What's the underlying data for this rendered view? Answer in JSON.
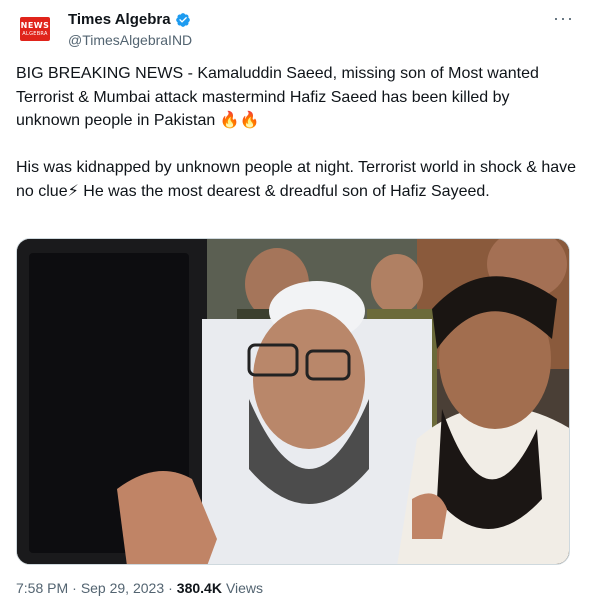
{
  "account": {
    "logo_text": "NEWS",
    "logo_subtext": "ALGEBRA",
    "display_name": "Times Algebra",
    "handle": "@TimesAlgebraIND",
    "verified": true
  },
  "menu": {
    "more_label": "···"
  },
  "tweet": {
    "text": "BIG BREAKING NEWS - Kamaluddin Saeed, missing son of Most wanted Terrorist & Mumbai attack mastermind Hafiz Saeed has been killed by unknown people in Pakistan 🔥🔥\n\nHis was kidnapped by unknown people at night. Terrorist world in shock & have no clue⚡ He was the most dearest & dreadful son of Hafiz Sayeed."
  },
  "meta": {
    "time": "7:58 PM",
    "separator1": "·",
    "date": "Sep 29, 2023",
    "separator2": "·",
    "views_count": "380.4K",
    "views_label": "Views"
  },
  "colors": {
    "logo_red": "#e0241b",
    "verified_blue": "#1d9bf0",
    "secondary_text": "#536471",
    "primary_text": "#0f1419"
  }
}
